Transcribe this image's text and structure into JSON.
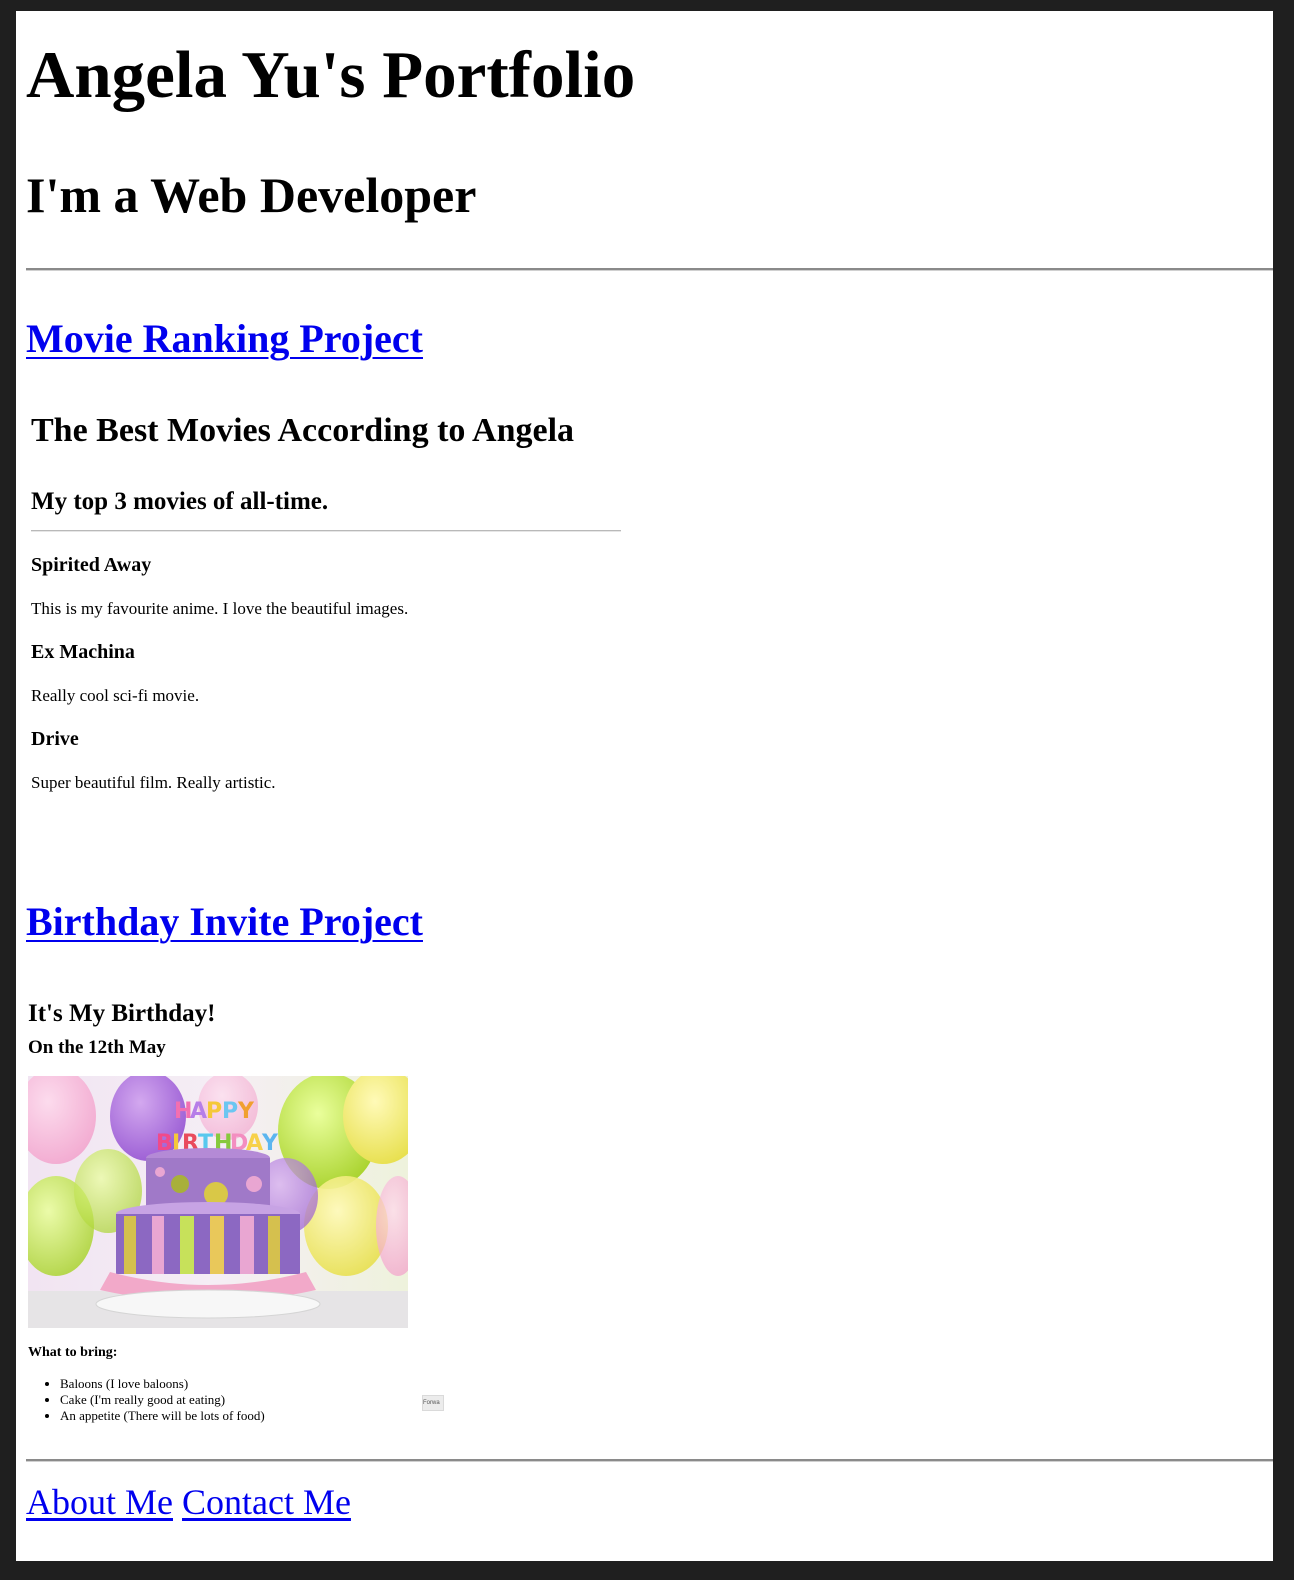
{
  "header": {
    "title": "Angela Yu's Portfolio",
    "subtitle": "I'm a Web Developer"
  },
  "projects": {
    "movie": {
      "link_label": "Movie Ranking Project",
      "title": "The Best Movies According to Angela",
      "subtitle": "My top 3 movies of all-time.",
      "items": [
        {
          "name": "Spirited Away",
          "desc": "This is my favourite anime. I love the beautiful images."
        },
        {
          "name": "Ex Machina",
          "desc": "Really cool sci-fi movie."
        },
        {
          "name": "Drive",
          "desc": "Super beautiful film. Really artistic."
        }
      ]
    },
    "birthday": {
      "link_label": "Birthday Invite Project",
      "title": "It's My Birthday!",
      "date": "On the 12th May",
      "image_topper_lines": [
        "HAPPY",
        "BIRTHDAY"
      ],
      "bring_title": "What to bring:",
      "bring_items": [
        "Baloons (I love baloons)",
        "Cake (I'm really good at eating)",
        "An appetite (There will be lots of food)"
      ],
      "forward_button_label": "Forwa"
    }
  },
  "footer": {
    "about_label": "About Me",
    "contact_label": "Contact Me"
  },
  "colors": {
    "link": "#0000ee",
    "frame_background": "#1f1f1f"
  }
}
